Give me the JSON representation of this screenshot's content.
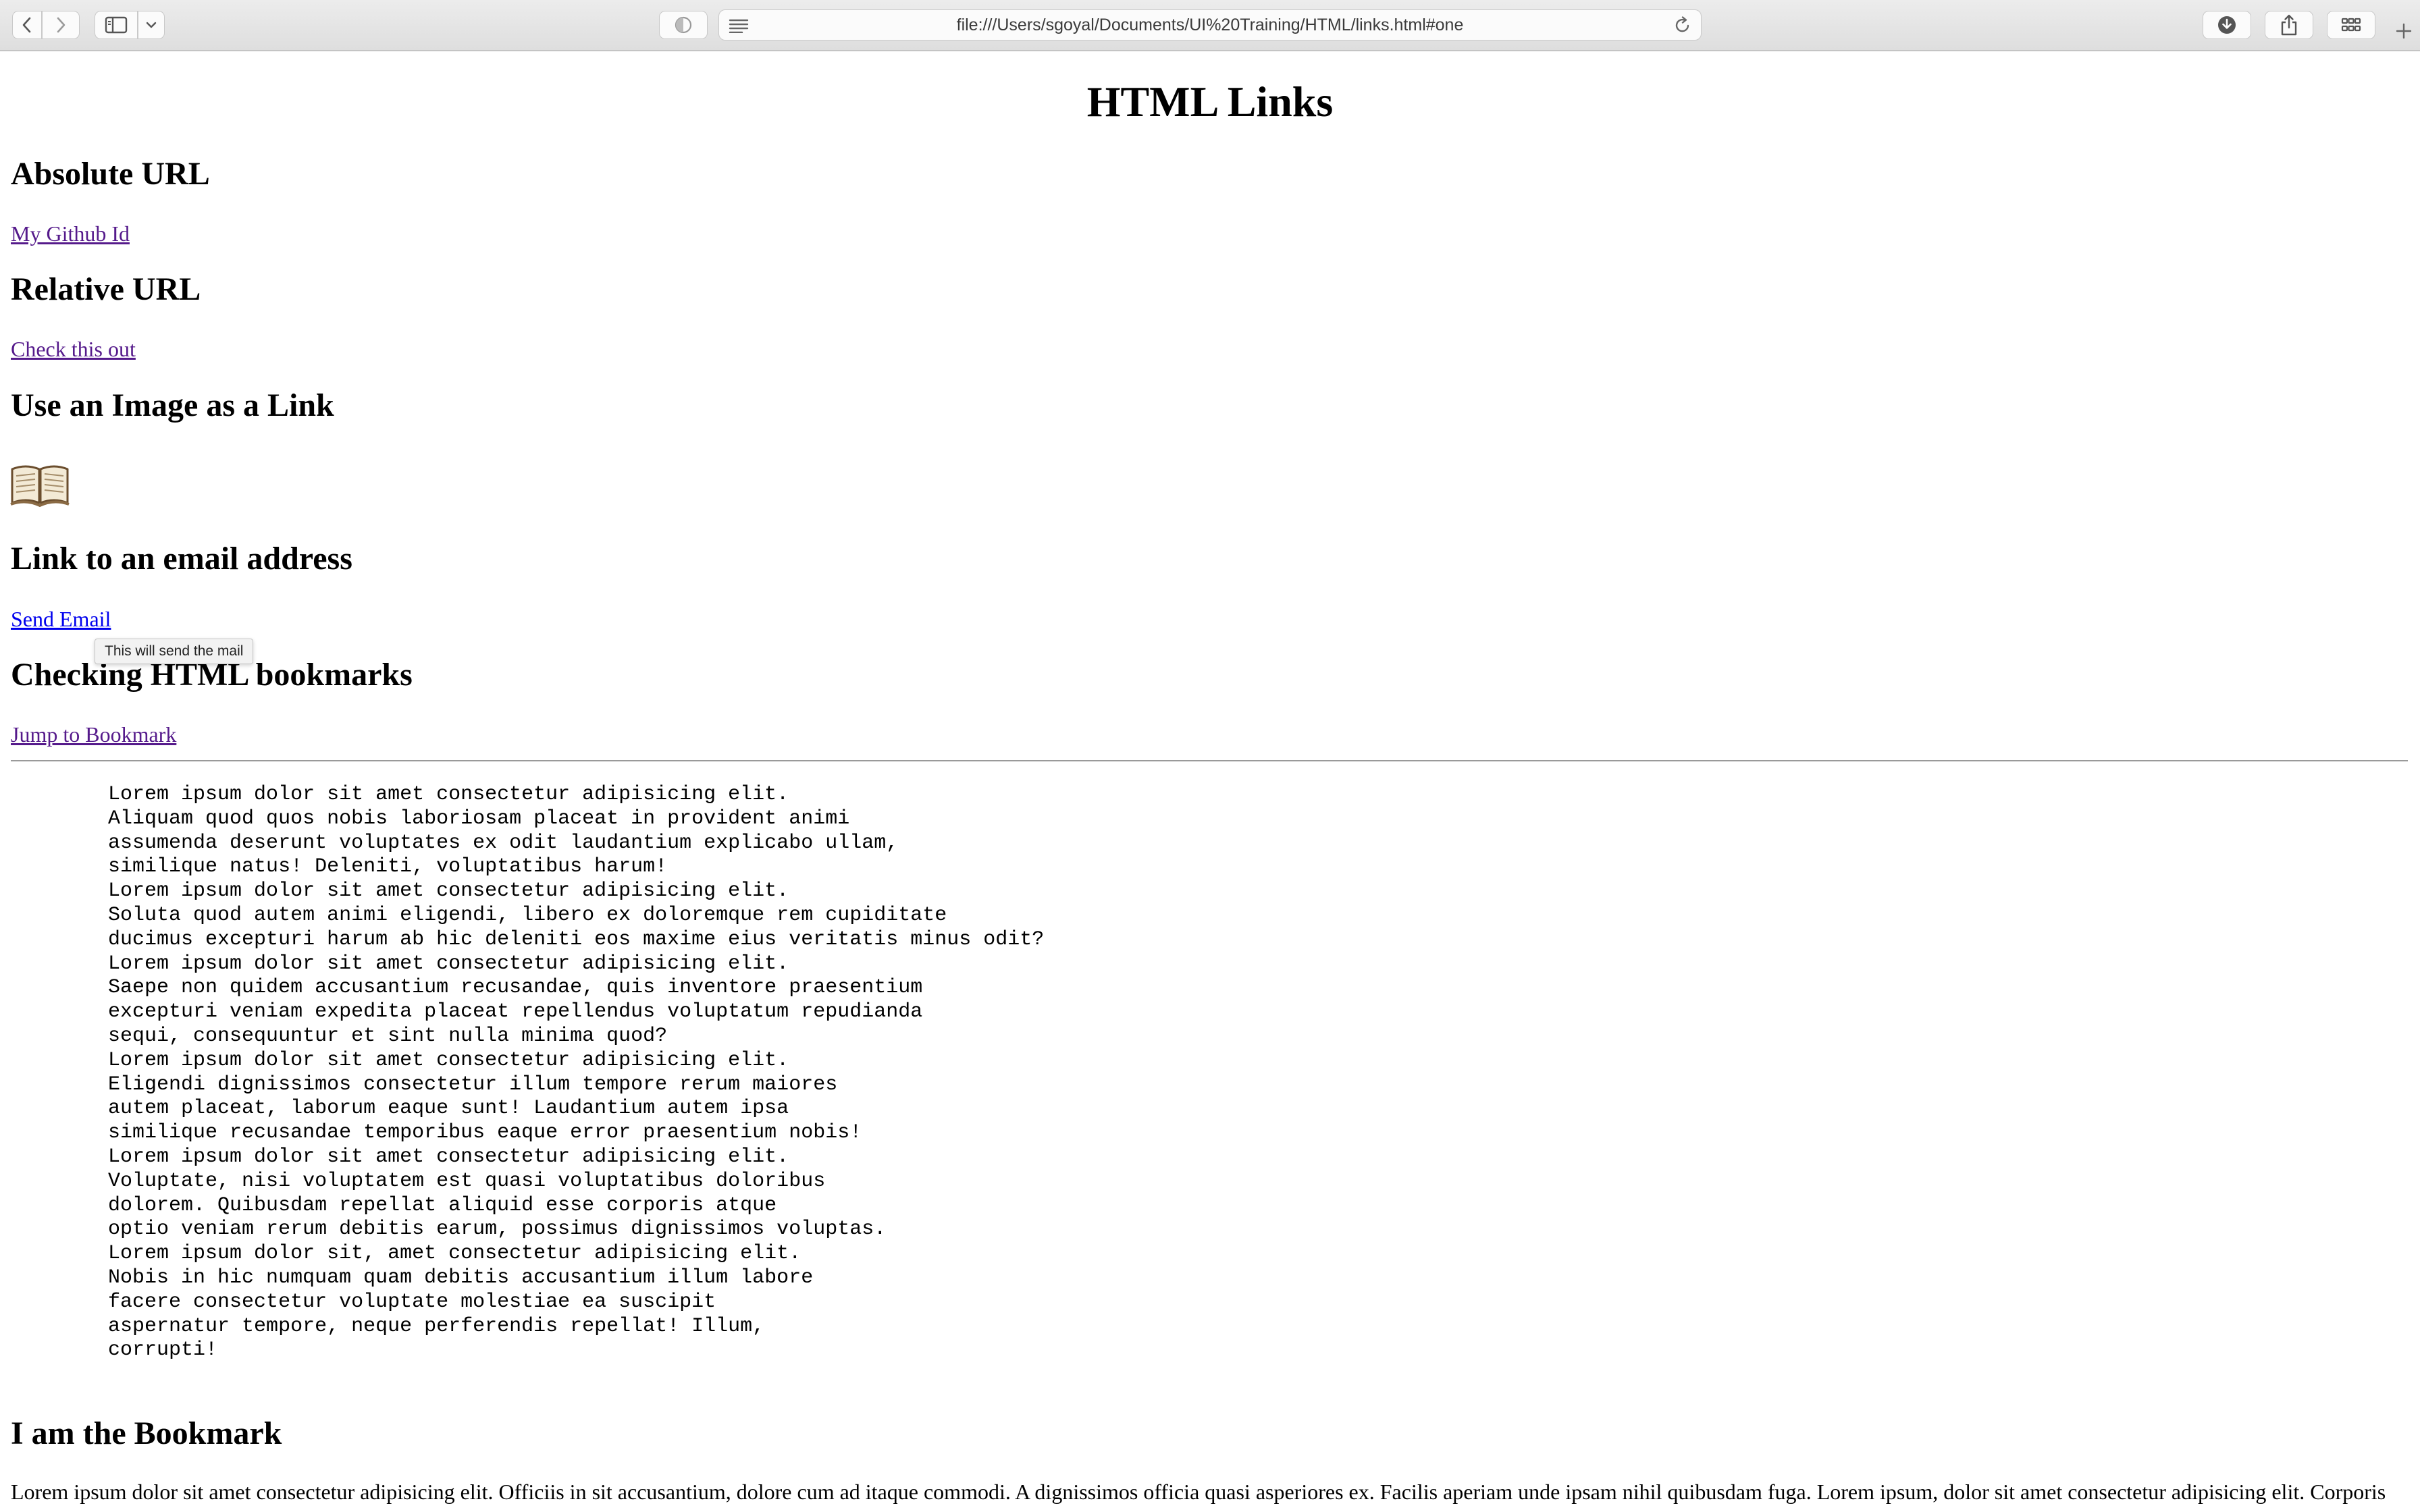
{
  "browser": {
    "url": "file:///Users/sgoyal/Documents/UI%20Training/HTML/links.html#one",
    "icons": {
      "back": "chevron-left-icon",
      "forward": "chevron-right-icon",
      "sidebar": "sidebar-icon",
      "privacy": "privacy-shield-icon",
      "reader": "reader-icon",
      "reload": "reload-icon",
      "download": "download-icon",
      "share": "share-icon",
      "tabs": "tab-overview-icon",
      "new_tab": "plus-icon"
    }
  },
  "page": {
    "title": "HTML Links",
    "sections": {
      "absolute": {
        "heading": "Absolute URL",
        "link": "My Github Id"
      },
      "relative": {
        "heading": "Relative URL",
        "link": "Check this out"
      },
      "image": {
        "heading": "Use an Image as a Link",
        "icon": "book-icon"
      },
      "email": {
        "heading": "Link to an email address",
        "link": "Send Email",
        "tooltip": "This will send the mail"
      },
      "bookmarks": {
        "heading": "Checking HTML bookmarks",
        "link": "Jump to Bookmark"
      },
      "bookmark_target": {
        "heading": "I am the Bookmark"
      }
    },
    "pre_text": "        Lorem ipsum dolor sit amet consectetur adipisicing elit.\n        Aliquam quod quos nobis laboriosam placeat in provident animi\n        assumenda deserunt voluptates ex odit laudantium explicabo ullam,\n        similique natus! Deleniti, voluptatibus harum!\n        Lorem ipsum dolor sit amet consectetur adipisicing elit.\n        Soluta quod autem animi eligendi, libero ex doloremque rem cupiditate\n        ducimus excepturi harum ab hic deleniti eos maxime eius veritatis minus odit?\n        Lorem ipsum dolor sit amet consectetur adipisicing elit.\n        Saepe non quidem accusantium recusandae, quis inventore praesentium\n        excepturi veniam expedita placeat repellendus voluptatum repudianda\n        sequi, consequuntur et sint nulla minima quod?\n        Lorem ipsum dolor sit amet consectetur adipisicing elit.\n        Eligendi dignissimos consectetur illum tempore rerum maiores\n        autem placeat, laborum eaque sunt! Laudantium autem ipsa\n        similique recusandae temporibus eaque error praesentium nobis!\n        Lorem ipsum dolor sit amet consectetur adipisicing elit.\n        Voluptate, nisi voluptatem est quasi voluptatibus doloribus\n        dolorem. Quibusdam repellat aliquid esse corporis atque\n        optio veniam rerum debitis earum, possimus dignissimos voluptas.\n        Lorem ipsum dolor sit, amet consectetur adipisicing elit.\n        Nobis in hic numquam quam debitis accusantium illum labore\n        facere consectetur voluptate molestiae ea suscipit\n        aspernatur tempore, neque perferendis repellat! Illum,\n        corrupti!",
    "bottom_paragraph": "Lorem ipsum dolor sit amet consectetur adipisicing elit. Officiis in sit accusantium, dolore cum ad itaque commodi. A dignissimos officia quasi asperiores ex. Facilis aperiam unde ipsam nihil quibusdam fuga. Lorem ipsum, dolor sit amet consectetur adipisicing elit. Corporis"
  }
}
